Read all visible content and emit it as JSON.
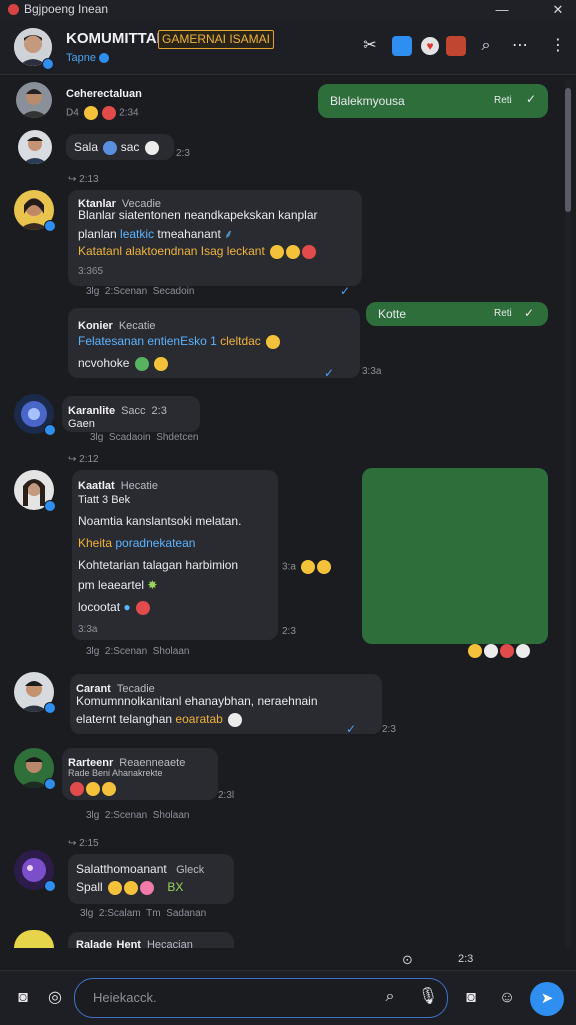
{
  "titlebar": {
    "title": "Bgjpoeng Inean",
    "minimize": "—",
    "close": "✕"
  },
  "header": {
    "title": "KOMUMITTAN",
    "badge": "GAMERNAI ISAMAI",
    "subtitle": "Tapne",
    "icons": [
      "tools-icon",
      "blue-app-icon",
      "heart-badge-icon",
      "gamepad-icon",
      "search-icon",
      "more-icon",
      "vertical-more-icon"
    ]
  },
  "messages": [
    {
      "sender": "Ceherectaluan",
      "meta": "D4",
      "time": "2:34"
    },
    {
      "sender": "Sala",
      "text2": "sac",
      "meta": "2:3"
    },
    {
      "reply": "↪ 2:13",
      "sender": "Ktanlar",
      "role": "Vecadie",
      "lines": [
        "Blanlar siatentonen neandkapekskan kanplar",
        "planlan",
        "leatkic",
        "tmeahanant"
      ],
      "gold": "Katatanl alaktoendnan Isag leckant",
      "time": "3:365",
      "meta": [
        "3lg",
        "2:Scenan",
        "Secadoin"
      ]
    },
    {
      "sender": "Konier",
      "role": "Kecatie",
      "blue": "Felatesanan entienEsko 1",
      "gold": "cleltdac",
      "line2": "ncvohoke",
      "time": "3:3a"
    },
    {
      "sender": "Karanlite",
      "role": "Sacc",
      "extra": "2:3",
      "line2": "Gaen",
      "meta": [
        "3lg",
        "Scadaoin",
        "Shdetcen"
      ]
    },
    {
      "reply": "↪ 2:12",
      "sender": "Kaatlat",
      "role": "Hecatie",
      "lines": [
        "Tiatt 3 Bek",
        "Noamtia kanslantsoki melatan.",
        "Kheita",
        "poradnekatean",
        "Kohtetarian talagan harbimion",
        "pm leaeartel",
        "locootat"
      ],
      "time": "3:3a",
      "meta": [
        "3lg",
        "2:Scenan",
        "Sholaan"
      ],
      "side": "3:a",
      "side2": "2:3"
    },
    {
      "sender": "Carant",
      "role": "Tecadie",
      "lines": [
        "Komumnnolkanitanl ehanaybhan, neraehnain",
        "elaternt telanghan",
        "eoaratab"
      ],
      "meta": "2:3"
    },
    {
      "sender": "Rarteenr",
      "role": "Reaenneaete",
      "line2": "Rade Beni Ahanakrekte",
      "meta": [
        "2:3l"
      ]
    },
    {
      "reply": "↪ 2:15",
      "sender": "Salatthomoanant",
      "role": "Gleck",
      "line2": "Spall",
      "extra": "BX",
      "meta": [
        "3lg",
        "2:Scalam",
        "Tm",
        "Sadanan"
      ]
    },
    {
      "sender": "Ralade",
      "role": "Hecacian",
      "extra": "Hent"
    }
  ],
  "outgoing": [
    {
      "text": "Blalekmyousa",
      "meta": "Reti"
    },
    {
      "text": "Kotte",
      "meta": "Reti"
    }
  ],
  "statusbar": {
    "left": "⊙",
    "right": "2:3"
  },
  "composer": {
    "placeholder": "Heiekacck."
  }
}
